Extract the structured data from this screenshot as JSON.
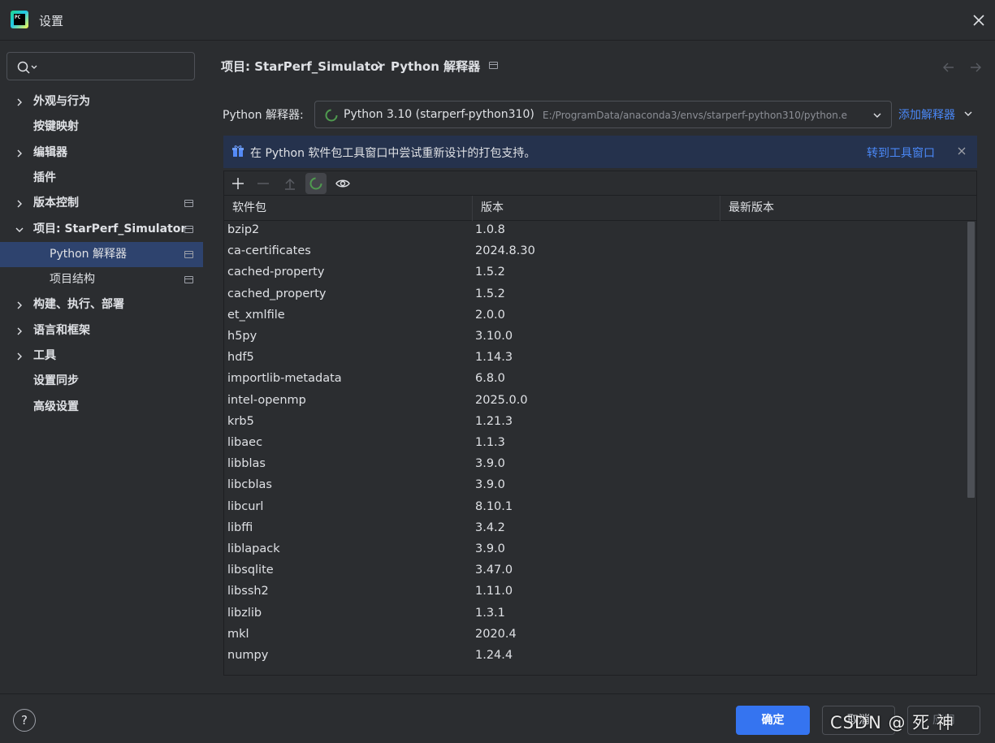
{
  "window": {
    "title": "设置",
    "app_icon_text": "PC"
  },
  "sidebar": {
    "search_placeholder": "",
    "items": [
      {
        "label": "外观与行为",
        "expandable": true,
        "expanded": false,
        "level": 0
      },
      {
        "label": "按键映射",
        "expandable": false,
        "level": 0
      },
      {
        "label": "编辑器",
        "expandable": true,
        "expanded": false,
        "level": 0
      },
      {
        "label": "插件",
        "expandable": false,
        "level": 0
      },
      {
        "label": "版本控制",
        "expandable": true,
        "expanded": false,
        "level": 0,
        "project_icon": true
      },
      {
        "label": "项目: StarPerf_Simulator",
        "expandable": true,
        "expanded": true,
        "level": 0,
        "project_icon": true
      },
      {
        "label": "Python 解释器",
        "expandable": false,
        "level": 1,
        "selected": true,
        "project_icon": true
      },
      {
        "label": "项目结构",
        "expandable": false,
        "level": 1,
        "project_icon": true
      },
      {
        "label": "构建、执行、部署",
        "expandable": true,
        "expanded": false,
        "level": 0
      },
      {
        "label": "语言和框架",
        "expandable": true,
        "expanded": false,
        "level": 0
      },
      {
        "label": "工具",
        "expandable": true,
        "expanded": false,
        "level": 0
      },
      {
        "label": "设置同步",
        "expandable": false,
        "level": 0
      },
      {
        "label": "高级设置",
        "expandable": false,
        "level": 0
      }
    ]
  },
  "breadcrumb": {
    "parent": "项目: StarPerf_Simulator",
    "current": "Python 解释器"
  },
  "interpreter": {
    "label": "Python 解释器:",
    "selected_name": "Python 3.10 (starperf-python310)",
    "selected_path": "E:/ProgramData/anaconda3/envs/starperf-python310/python.e",
    "add_label": "添加解释器"
  },
  "banner": {
    "text": "在 Python 软件包工具窗口中尝试重新设计的打包支持。",
    "link": "转到工具窗口"
  },
  "toolbar": {
    "buttons": [
      "plus-icon",
      "minus-icon",
      "upgrade-icon",
      "loading-icon",
      "eye-icon"
    ]
  },
  "packages": {
    "columns": [
      "软件包",
      "版本",
      "最新版本"
    ],
    "rows": [
      {
        "name": "bzip2",
        "version": "1.0.8",
        "latest": ""
      },
      {
        "name": "ca-certificates",
        "version": "2024.8.30",
        "latest": ""
      },
      {
        "name": "cached-property",
        "version": "1.5.2",
        "latest": ""
      },
      {
        "name": "cached_property",
        "version": "1.5.2",
        "latest": ""
      },
      {
        "name": "et_xmlfile",
        "version": "2.0.0",
        "latest": ""
      },
      {
        "name": "h5py",
        "version": "3.10.0",
        "latest": ""
      },
      {
        "name": "hdf5",
        "version": "1.14.3",
        "latest": ""
      },
      {
        "name": "importlib-metadata",
        "version": "6.8.0",
        "latest": ""
      },
      {
        "name": "intel-openmp",
        "version": "2025.0.0",
        "latest": ""
      },
      {
        "name": "krb5",
        "version": "1.21.3",
        "latest": ""
      },
      {
        "name": "libaec",
        "version": "1.1.3",
        "latest": ""
      },
      {
        "name": "libblas",
        "version": "3.9.0",
        "latest": ""
      },
      {
        "name": "libcblas",
        "version": "3.9.0",
        "latest": ""
      },
      {
        "name": "libcurl",
        "version": "8.10.1",
        "latest": ""
      },
      {
        "name": "libffi",
        "version": "3.4.2",
        "latest": ""
      },
      {
        "name": "liblapack",
        "version": "3.9.0",
        "latest": ""
      },
      {
        "name": "libsqlite",
        "version": "3.47.0",
        "latest": ""
      },
      {
        "name": "libssh2",
        "version": "1.11.0",
        "latest": ""
      },
      {
        "name": "libzlib",
        "version": "1.3.1",
        "latest": ""
      },
      {
        "name": "mkl",
        "version": "2020.4",
        "latest": ""
      },
      {
        "name": "numpy",
        "version": "1.24.4",
        "latest": ""
      }
    ]
  },
  "footer": {
    "help": "?",
    "ok": "确定",
    "cancel": "取消",
    "apply": "应用"
  },
  "watermark": "CSDN @  死 神",
  "colors": {
    "accent": "#3574f0",
    "link": "#4a88f7",
    "selection": "#2e436e",
    "banner": "#25324d",
    "background": "#2b2d30"
  }
}
